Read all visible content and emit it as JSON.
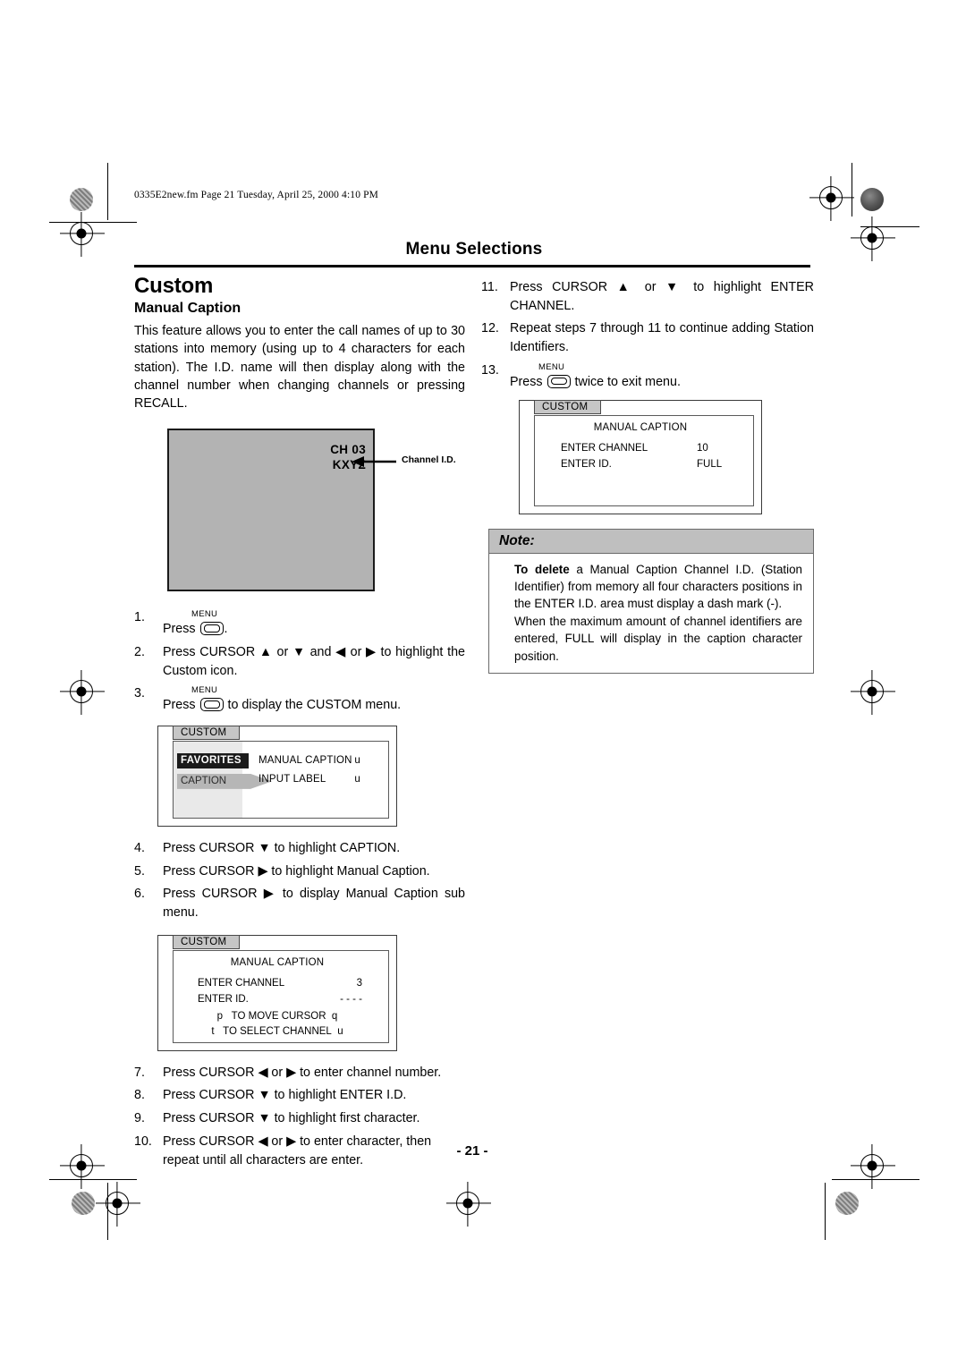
{
  "print_marks": {
    "filename_line": "0335E2new.fm  Page 21  Tuesday, April 25, 2000  4:10 PM"
  },
  "header": {
    "title": "Menu Selections"
  },
  "footer": {
    "page_number": "- 21 -"
  },
  "left_column": {
    "section_title": "Custom",
    "sub_title": "Manual Caption",
    "intro_paragraph": "This feature allows you to enter the call names of up to 30 stations into memory (using up to 4 characters for each station). The I.D. name will then display along with the channel number when changing channels or pressing RECALL.",
    "tv_illustration": {
      "osd_channel": "CH 03",
      "osd_callsign": "KXYZ",
      "callout_label": "Channel I.D.",
      "screen_color": "#b3b3b3"
    },
    "steps": [
      {
        "num": "1.",
        "text_before": "Press",
        "key": "MENU",
        "text_after": "."
      },
      {
        "num": "2.",
        "text": "Press CURSOR ▲ or ▼ and ◀ or ▶ to highlight the Custom icon."
      },
      {
        "num": "3.",
        "text_before": "Press",
        "key": "MENU",
        "text_after": "to display the CUSTOM menu."
      },
      {
        "num": "4.",
        "text": "Press CURSOR ▼ to highlight CAPTION."
      },
      {
        "num": "5.",
        "text": "Press CURSOR ▶ to highlight Manual Caption."
      },
      {
        "num": "6.",
        "text": "Press CURSOR ▶ to display Manual Caption sub menu."
      },
      {
        "num": "7.",
        "text": "Press CURSOR ◀ or ▶ to enter channel number."
      },
      {
        "num": "8.",
        "text": "Press CURSOR ▼ to highlight ENTER I.D."
      },
      {
        "num": "9.",
        "text": "Press CURSOR ▼ to highlight first character."
      },
      {
        "num": "10.",
        "text": "Press CURSOR ◀ or ▶ to enter character, then repeat until all characters are enter."
      }
    ],
    "custom_menu": {
      "tab_label": "CUSTOM",
      "item_favorites": "FAVORITES",
      "item_caption": "CAPTION",
      "right_items": [
        {
          "label": "MANUAL CAPTION",
          "glyph": "u"
        },
        {
          "label": "INPUT LABEL",
          "glyph": "u"
        }
      ]
    },
    "manual_caption_menu": {
      "tab_label": "CUSTOM",
      "title": "MANUAL CAPTION",
      "rows": [
        {
          "label": "ENTER CHANNEL",
          "value": "3"
        },
        {
          "label": "ENTER ID.",
          "value": "- - - -"
        }
      ],
      "hint_move_cursor_left": "p",
      "hint_move_cursor": "TO MOVE CURSOR",
      "hint_move_cursor_right": "q",
      "hint_select_channel_left": "t",
      "hint_select_channel": "TO SELECT CHANNEL",
      "hint_select_channel_right": "u"
    }
  },
  "right_column": {
    "steps": [
      {
        "num": "11.",
        "text": "Press CURSOR ▲ or ▼ to highlight ENTER CHANNEL."
      },
      {
        "num": "12.",
        "text": "Repeat steps 7 through 11 to continue adding Station Identifiers."
      },
      {
        "num": "13.",
        "text_before": "Press",
        "key": "MENU",
        "text_after": "twice to exit menu."
      }
    ],
    "manual_caption_menu": {
      "tab_label": "CUSTOM",
      "title": "MANUAL CAPTION",
      "rows": [
        {
          "label": "ENTER CHANNEL",
          "value": "10"
        },
        {
          "label": "ENTER ID.",
          "value": "FULL"
        }
      ]
    },
    "note": {
      "heading": "Note:",
      "para1_bold": "To delete",
      "para1_rest": " a Manual Caption Channel I.D. (Station Identifier) from memory all four characters positions in the  ENTER I.D.  area must display a dash mark (-).",
      "para2": "When the maximum amount of channel identifiers are entered,  FULL  will display in the caption character position."
    }
  }
}
